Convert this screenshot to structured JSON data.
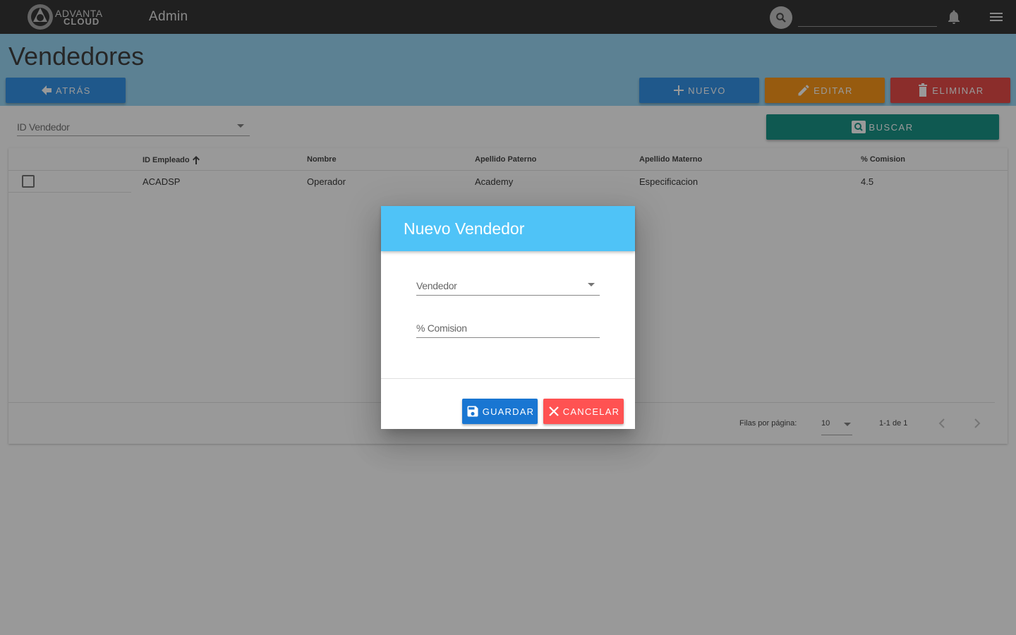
{
  "topbar": {
    "logo_line1": "ADVANTA",
    "logo_line2": "CLOUD",
    "title": "Admin",
    "search_value": ""
  },
  "page": {
    "title": "Vendedores"
  },
  "actions": {
    "back_label": "ATRÁS",
    "new_label": "NUEVO",
    "edit_label": "EDITAR",
    "delete_label": "ELIMINAR",
    "search_label": "BUSCAR"
  },
  "filter": {
    "label": "ID Vendedor"
  },
  "table": {
    "columns": [
      "ID Empleado",
      "Nombre",
      "Apellido Paterno",
      "Apellido Materno",
      "% Comision"
    ],
    "sort_column": "ID Empleado",
    "sort_direction": "asc",
    "rows": [
      [
        "ACADSP",
        "Operador",
        "Academy",
        "Especificacion",
        "4.5"
      ]
    ],
    "footer": {
      "rows_per_page_label": "Filas por página:",
      "rows_per_page_value": "10",
      "range": "1-1 de 1"
    }
  },
  "dialog": {
    "title": "Nuevo Vendedor",
    "vendor_label": "Vendedor",
    "commission_placeholder": "% Comision",
    "save_label": "GUARDAR",
    "cancel_label": "CANCELAR"
  },
  "colors": {
    "topbar": "#212121",
    "header_band": "#8fd3f4",
    "primary": "#1e88e5",
    "warning": "#fb8c00",
    "danger": "#e53935",
    "teal": "#00897b",
    "dialog_header": "#4fc3f7",
    "cancel": "#ff5252"
  },
  "icons": [
    "logo-icon",
    "search-icon",
    "bell-icon",
    "menu-icon",
    "arrow-left-icon",
    "plus-icon",
    "pencil-icon",
    "trash-icon",
    "magnify-icon",
    "arrow-up-icon",
    "caret-down-icon",
    "chevron-left-icon",
    "chevron-right-icon",
    "floppy-icon",
    "close-icon"
  ]
}
